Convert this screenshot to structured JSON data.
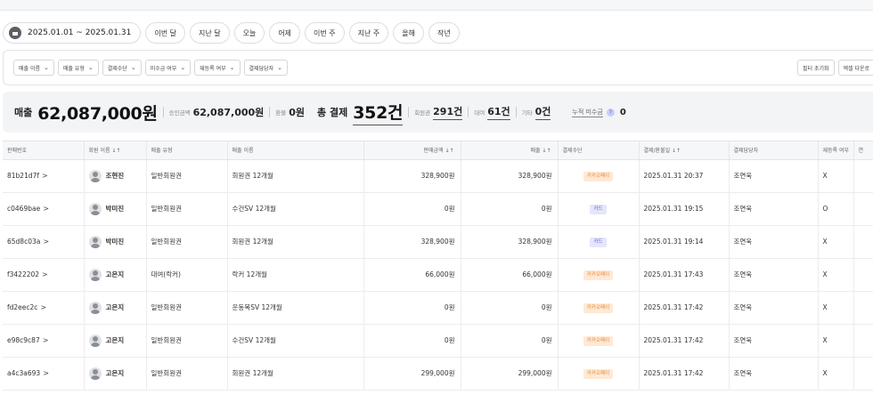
{
  "date_range": "2025.01.01 ~ 2025.01.31",
  "quick_filters": [
    "이번 달",
    "지난 달",
    "오늘",
    "어제",
    "이번 주",
    "지난 주",
    "올해",
    "작년"
  ],
  "filters": [
    "매출 이름",
    "매출 유형",
    "결제수단",
    "미수금 여부",
    "재등록 여부",
    "결제담당자"
  ],
  "actions": {
    "reset": "필터 초기화",
    "excel": "엑셀 다운로"
  },
  "summary": {
    "sales_label": "매출",
    "sales_value": "62,087,000원",
    "approved_label": "승인금액",
    "approved_value": "62,087,000원",
    "refund_label": "환불",
    "refund_value": "0원",
    "total_label": "총 결제",
    "total_value": "352건",
    "member_label": "회원권",
    "member_value": "291건",
    "rental_label": "대여",
    "rental_value": "61건",
    "other_label": "기타",
    "other_value": "0건",
    "accum_label": "누적 미수금",
    "accum_info": "?",
    "accum_value": "0"
  },
  "table": {
    "headers": [
      "판매번호",
      "회원 이름 ↓↑",
      "매출 유형",
      "매출 이름",
      "판매금액 ↓↑",
      "매출 ↓↑",
      "결제수단",
      "결제/환불일 ↓↑",
      "결제담당자",
      "재등록 여부",
      "연"
    ],
    "rows": [
      {
        "id": "81b21d7f",
        "name": "조현진",
        "type": "일반회원권",
        "item": "회원권 12개월",
        "price": "328,900원",
        "sales": "328,900원",
        "method": "카카오페이",
        "method_kind": "kakao",
        "date": "2025.01.31 20:37",
        "staff": "조연욱",
        "rereg": "X"
      },
      {
        "id": "c0469bae",
        "name": "박미진",
        "type": "일반회원권",
        "item": "수건SV 12개월",
        "price": "0원",
        "sales": "0원",
        "method": "카드",
        "method_kind": "card",
        "date": "2025.01.31 19:15",
        "staff": "조연욱",
        "rereg": "O"
      },
      {
        "id": "65d8c03a",
        "name": "박미진",
        "type": "일반회원권",
        "item": "회원권 12개월",
        "price": "328,900원",
        "sales": "328,900원",
        "method": "카드",
        "method_kind": "card",
        "date": "2025.01.31 19:14",
        "staff": "조연욱",
        "rereg": "X"
      },
      {
        "id": "f3422202",
        "name": "고은지",
        "type": "대여(락커)",
        "item": "락커 12개월",
        "price": "66,000원",
        "sales": "66,000원",
        "method": "카카오페이",
        "method_kind": "kakao",
        "date": "2025.01.31 17:43",
        "staff": "조연욱",
        "rereg": "X"
      },
      {
        "id": "fd2eec2c",
        "name": "고은지",
        "type": "일반회원권",
        "item": "운동복SV 12개월",
        "price": "0원",
        "sales": "0원",
        "method": "카카오페이",
        "method_kind": "kakao",
        "date": "2025.01.31 17:42",
        "staff": "조연욱",
        "rereg": "X"
      },
      {
        "id": "e98c9c87",
        "name": "고은지",
        "type": "일반회원권",
        "item": "수건SV 12개월",
        "price": "0원",
        "sales": "0원",
        "method": "카카오페이",
        "method_kind": "kakao",
        "date": "2025.01.31 17:42",
        "staff": "조연욱",
        "rereg": "X"
      },
      {
        "id": "a4c3a693",
        "name": "고은지",
        "type": "일반회원권",
        "item": "회원권 12개월",
        "price": "299,000원",
        "sales": "299,000원",
        "method": "카카오페이",
        "method_kind": "kakao",
        "date": "2025.01.31 17:42",
        "staff": "조연욱",
        "rereg": "X"
      }
    ]
  }
}
